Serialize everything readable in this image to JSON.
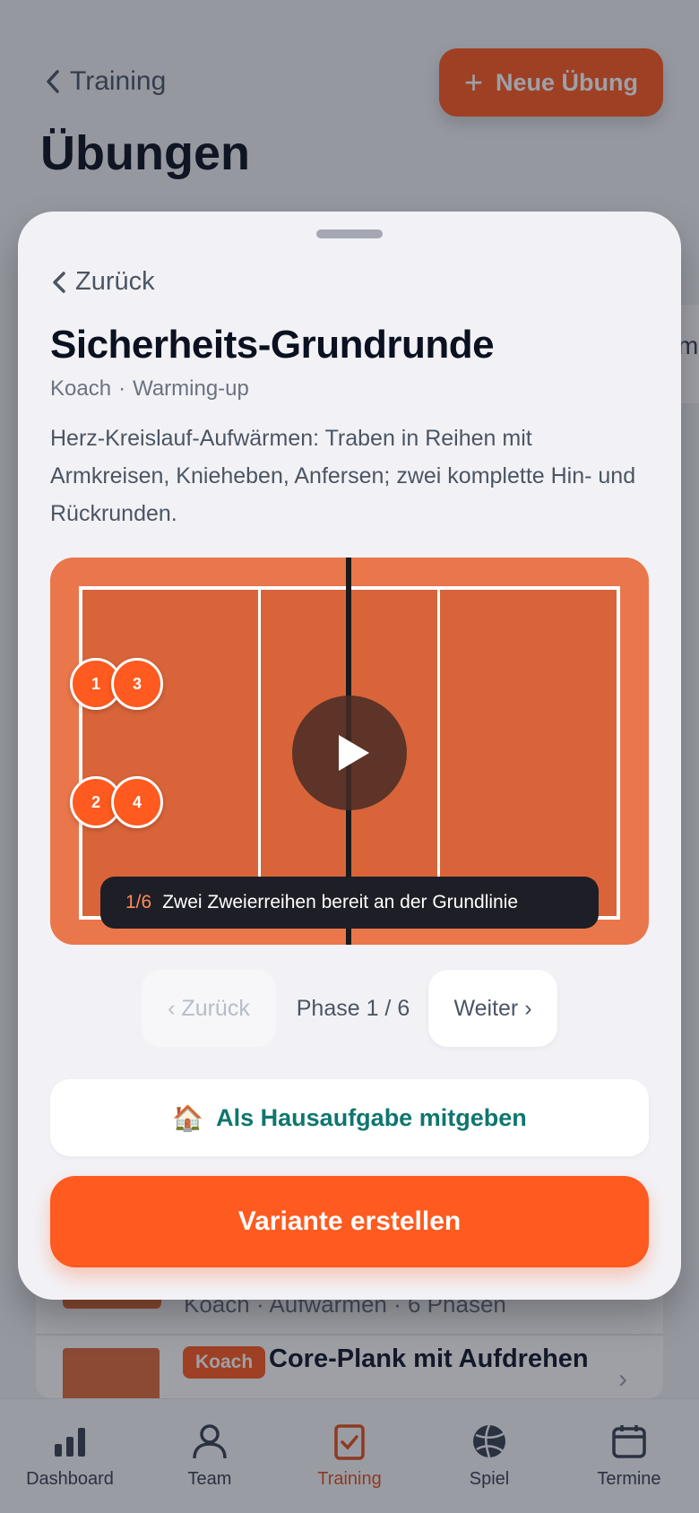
{
  "background": {
    "back_label": "Training",
    "new_button": "Neue Übung",
    "page_title": "Übungen",
    "tab_peek": "me",
    "list": {
      "row1_meta": "Koach · Aufwärmen · 6 Phasen",
      "row2_badge": "Koach",
      "row2_title": "Core-Plank mit Aufdrehen"
    }
  },
  "nav": [
    {
      "label": "Dashboard",
      "icon": "bar-chart-icon"
    },
    {
      "label": "Team",
      "icon": "person-icon"
    },
    {
      "label": "Training",
      "icon": "clipboard-check-icon"
    },
    {
      "label": "Spiel",
      "icon": "volleyball-icon"
    },
    {
      "label": "Termine",
      "icon": "calendar-icon"
    }
  ],
  "sheet": {
    "back_label": "Zurück",
    "title": "Sicherheits-Grundrunde",
    "author": "Koach",
    "separator": "·",
    "category": "Warming-up",
    "description": "Herz-Kreislauf-Aufwärmen: Traben in Reihen mit Armkreisen, Knieheben, Anfersen; zwei komplette Hin- und Rückrunden.",
    "court": {
      "players": [
        "1",
        "3",
        "2",
        "4"
      ],
      "phase_num": "1/6",
      "phase_text": "Zwei Zweierreihen bereit an der Grundlinie"
    },
    "controls": {
      "prev": "‹ Zurück",
      "phase_label": "Phase 1 / 6",
      "next": "Weiter ›"
    },
    "homework_emoji": "🏠",
    "homework_label": "Als Hausaufgabe mitgeben",
    "variant_label": "Variante erstellen"
  },
  "colors": {
    "accent": "#ff5a1f",
    "court": "#d9643a",
    "teal": "#0f766e"
  }
}
